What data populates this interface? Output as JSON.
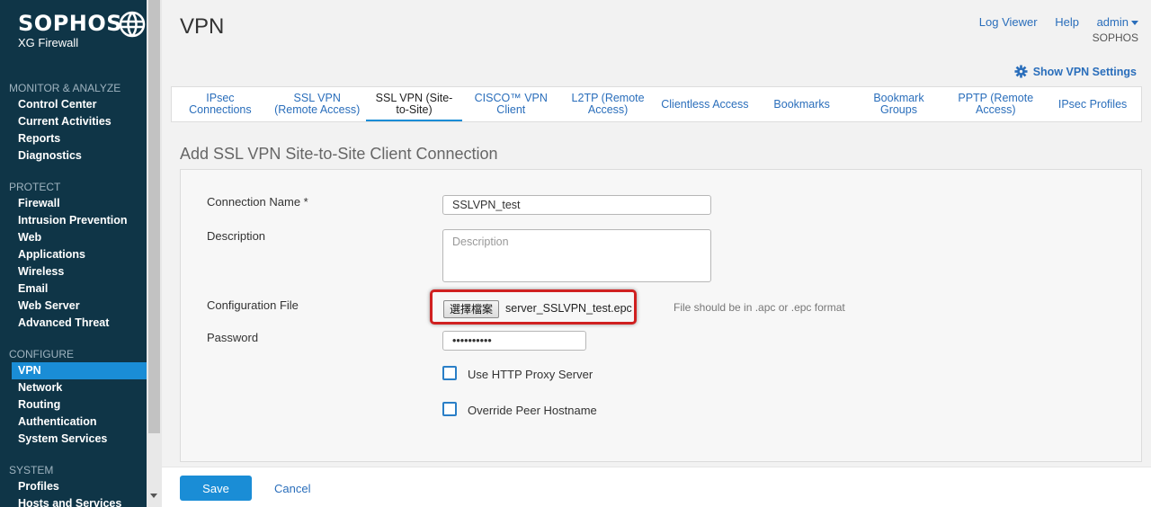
{
  "brand": {
    "name": "SOPHOS",
    "product": "XG Firewall"
  },
  "sidebar": {
    "sections": [
      {
        "title": "MONITOR & ANALYZE",
        "items": [
          "Control Center",
          "Current Activities",
          "Reports",
          "Diagnostics"
        ]
      },
      {
        "title": "PROTECT",
        "items": [
          "Firewall",
          "Intrusion Prevention",
          "Web",
          "Applications",
          "Wireless",
          "Email",
          "Web Server",
          "Advanced Threat"
        ]
      },
      {
        "title": "CONFIGURE",
        "items": [
          "VPN",
          "Network",
          "Routing",
          "Authentication",
          "System Services"
        ]
      },
      {
        "title": "SYSTEM",
        "items": [
          "Profiles",
          "Hosts and Services"
        ]
      }
    ],
    "active_item": "VPN"
  },
  "header": {
    "title": "VPN",
    "log_viewer": "Log Viewer",
    "help": "Help",
    "user": "admin",
    "org": "SOPHOS",
    "show_settings": "Show VPN Settings"
  },
  "tabs": [
    {
      "label": "IPsec Connections",
      "active": false
    },
    {
      "label": "SSL VPN (Remote Access)",
      "active": false
    },
    {
      "label": "SSL VPN (Site-to-Site)",
      "active": true
    },
    {
      "label": "CISCO™ VPN Client",
      "active": false
    },
    {
      "label": "L2TP (Remote Access)",
      "active": false
    },
    {
      "label": "Clientless Access",
      "active": false
    },
    {
      "label": "Bookmarks",
      "active": false
    },
    {
      "label": "Bookmark Groups",
      "active": false
    },
    {
      "label": "PPTP (Remote Access)",
      "active": false
    },
    {
      "label": "IPsec Profiles",
      "active": false
    }
  ],
  "form": {
    "title": "Add SSL VPN Site-to-Site Client Connection",
    "connection_name_label": "Connection Name *",
    "connection_name_value": "SSLVPN_test",
    "description_label": "Description",
    "description_placeholder": "Description",
    "config_file_label": "Configuration File",
    "choose_file_button": "選擇檔案",
    "file_name": "server_SSLVPN_test.epc",
    "file_hint": "File should be in .apc or .epc format",
    "password_label": "Password",
    "password_value": "••••••••••",
    "http_proxy_label": "Use HTTP Proxy Server",
    "override_hostname_label": "Override Peer Hostname"
  },
  "footer": {
    "save": "Save",
    "cancel": "Cancel"
  },
  "colors": {
    "sidebar_bg": "#0f3547",
    "accent": "#1a8dd6",
    "link": "#2a6ebb",
    "highlight_box": "#d02020"
  }
}
